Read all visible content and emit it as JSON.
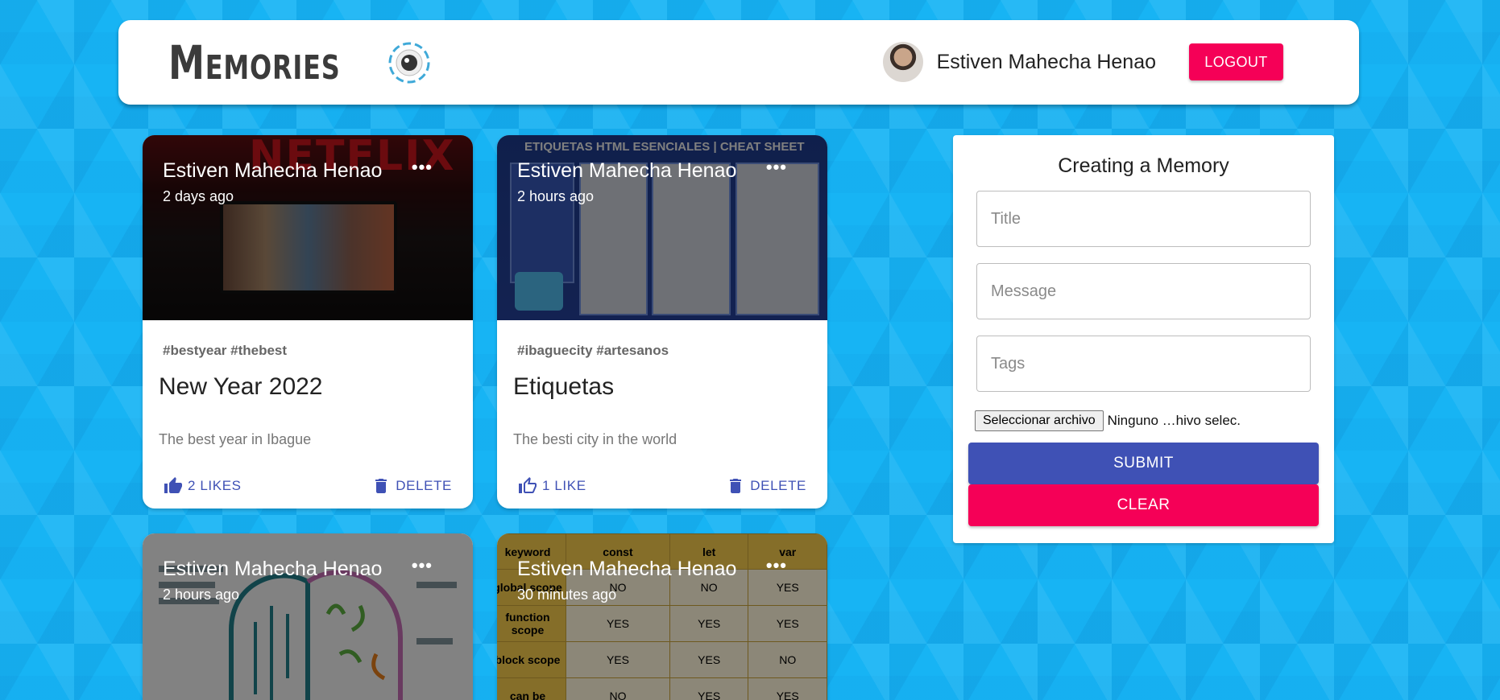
{
  "appbar": {
    "title": "Memories",
    "user_name": "Estiven Mahecha Henao",
    "logout_label": "LOGOUT"
  },
  "posts": [
    {
      "creator": "Estiven Mahecha Henao",
      "time": "2 days ago",
      "more": "•••",
      "image_text": "NETFLIX",
      "tags": "#bestyear #thebest",
      "title": "New Year 2022",
      "message": "The best year in Ibague",
      "likes_label": "2 LIKES",
      "delete_label": "DELETE"
    },
    {
      "creator": "Estiven Mahecha Henao",
      "time": "2 hours ago",
      "more": "•••",
      "image_text": "ETIQUETAS HTML ESENCIALES | CHEAT SHEET",
      "tags": "#ibaguecity #artesanos",
      "title": "Etiquetas",
      "message": "The besti city in the world",
      "likes_label": "1 LIKE",
      "delete_label": "DELETE"
    },
    {
      "creator": "Estiven Mahecha Henao",
      "time": "2 hours ago",
      "more": "•••"
    },
    {
      "creator": "Estiven Mahecha Henao",
      "time": "30 minutes ago",
      "more": "•••",
      "table": {
        "headers": [
          "keyword",
          "const",
          "let",
          "var"
        ],
        "rows": [
          [
            "global scope",
            "NO",
            "NO",
            "YES"
          ],
          [
            "function scope",
            "YES",
            "YES",
            "YES"
          ],
          [
            "block scope",
            "YES",
            "YES",
            "NO"
          ],
          [
            "can be",
            "NO",
            "YES",
            "YES"
          ]
        ]
      }
    }
  ],
  "form": {
    "heading": "Creating a Memory",
    "title_placeholder": "Title",
    "message_placeholder": "Message",
    "tags_placeholder": "Tags",
    "file_button": "Seleccionar archivo",
    "file_status": "Ninguno …hivo selec.",
    "submit_label": "SUBMIT",
    "clear_label": "CLEAR"
  },
  "colors": {
    "background": "#17b4f4",
    "primary": "#3f51b5",
    "secondary": "#f50057"
  }
}
